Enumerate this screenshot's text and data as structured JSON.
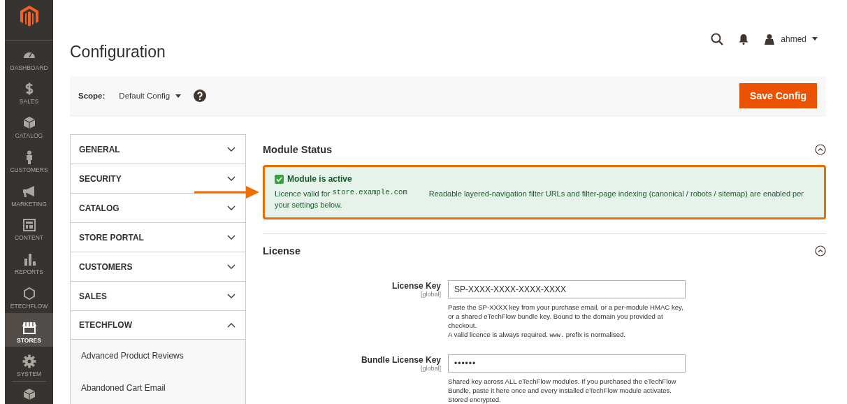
{
  "sidebar": {
    "items": [
      {
        "kind": "gauge",
        "label": "DASHBOARD",
        "selected": false
      },
      {
        "kind": "dollar",
        "label": "SALES",
        "selected": false
      },
      {
        "kind": "cube",
        "label": "CATALOG",
        "selected": false
      },
      {
        "kind": "person",
        "label": "CUSTOMERS",
        "selected": false
      },
      {
        "kind": "megaphone",
        "label": "MARKETING",
        "selected": false
      },
      {
        "kind": "layout",
        "label": "CONTENT",
        "selected": false
      },
      {
        "kind": "bars",
        "label": "REPORTS",
        "selected": false
      },
      {
        "kind": "hexagon",
        "label": "ETECHFLOW",
        "selected": false
      },
      {
        "kind": "store",
        "label": "STORES",
        "selected": true
      },
      {
        "kind": "gear",
        "label": "SYSTEM",
        "selected": false
      }
    ],
    "extra": {
      "kind": "blocks"
    }
  },
  "header": {
    "title": "Configuration",
    "user": "ahmed"
  },
  "scope": {
    "label": "Scope:",
    "value": "Default Config"
  },
  "save_button": "Save Config",
  "nav": [
    {
      "label": "GENERAL",
      "expanded": false
    },
    {
      "label": "SECURITY",
      "expanded": false
    },
    {
      "label": "CATALOG",
      "expanded": false
    },
    {
      "label": "STORE PORTAL",
      "expanded": false
    },
    {
      "label": "CUSTOMERS",
      "expanded": false
    },
    {
      "label": "SALES",
      "expanded": false
    },
    {
      "label": "ETECHFLOW",
      "expanded": true,
      "children": [
        {
          "label": "Advanced Product Reviews"
        },
        {
          "label": "Abandoned Cart Email"
        }
      ]
    }
  ],
  "module_status": {
    "title": "Module Status",
    "expanded": true,
    "status": {
      "checked": true,
      "heading": "Module is active",
      "licence_prefix": "Licence valid for",
      "domain": "store.example.com",
      "description": "Readable layered-navigation filter URLs and filter-page indexing (canonical / robots / sitemap) are enabled per your settings below."
    }
  },
  "license": {
    "title": "License",
    "expanded": true,
    "fields": [
      {
        "kind": "text",
        "label": "License Key",
        "scope": "[global]",
        "value": "SP-XXXX-XXXX-XXXX-XXXX",
        "notes": [
          {
            "text": "Paste the SP-XXXX key from your purchase email, or a per-module HMAC key, or a shared eTechFlow bundle key. Bound to the domain you provided at checkout."
          },
          {
            "text": "A valid licence is always required.",
            "code": "www.",
            "after": "prefix is normalised."
          }
        ]
      },
      {
        "kind": "password",
        "label": "Bundle License Key",
        "scope": "[global]",
        "value": "••••••",
        "notes": [
          {
            "text": "Shared key across ALL eTechFlow modules. If you purchased the eTechFlow Bundle, paste it here once and every installed eTechFlow module activates. Stored encrypted."
          }
        ]
      }
    ]
  }
}
